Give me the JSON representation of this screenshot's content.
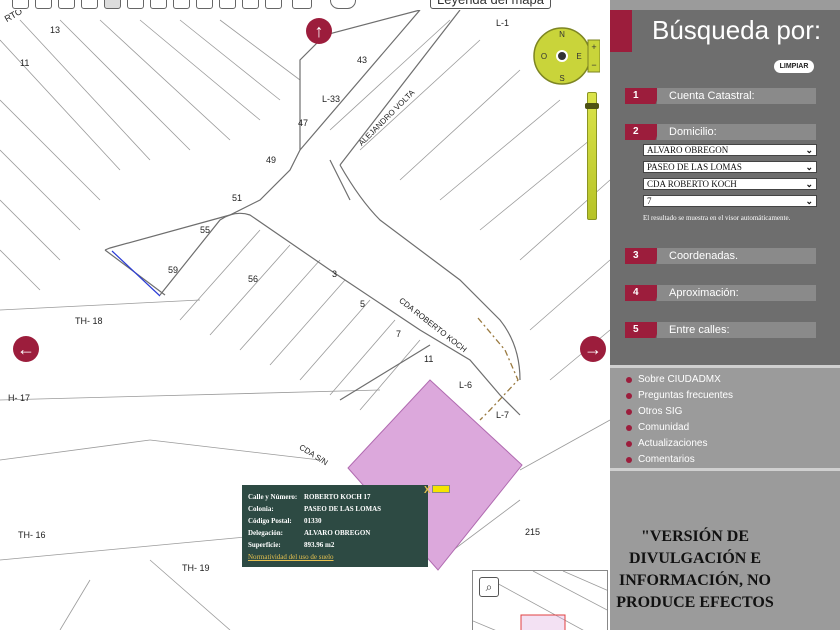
{
  "toolbar": {
    "tools": [
      "pan-tool",
      "zoom-in-tool",
      "zoom-out-tool",
      "extent-tool",
      "select-tool",
      "info-tool",
      "identify-tool",
      "measure-tool",
      "search-tool",
      "marker-tool",
      "route-tool",
      "area-tool",
      "print-tool",
      "view-tool"
    ],
    "legend_label": "Leyenda del mapa"
  },
  "map": {
    "labels": {
      "arto": "RTO",
      "n13": "13",
      "n11": "11",
      "l1": "L-1",
      "n43": "43",
      "l33": "L-33",
      "alejandro": "ALEJANDRO VOLTA",
      "n47": "47",
      "n49": "49",
      "n51": "51",
      "n55": "55",
      "n59": "59",
      "n56": "56",
      "n3": "3",
      "n5": "5",
      "n7": "7",
      "n11b": "11",
      "cda_roberto": "CDA ROBERTO KOCH",
      "l6": "L-6",
      "l7": "L-7",
      "th18": "TH- 18",
      "h17": "H- 17",
      "cda_sn": "CDA S/N",
      "n215": "215",
      "th16": "TH- 16",
      "th19": "TH- 19"
    },
    "colors": {
      "parcel": "#dca8dc",
      "street_line": "#6e6e6e",
      "accent": "#9c1d3c",
      "compass": "#c9d43a"
    },
    "compass": {
      "n": "N",
      "s": "S",
      "o": "O",
      "e": "E"
    }
  },
  "popup": {
    "rows": [
      {
        "k": "Calle y Número:",
        "v": "ROBERTO KOCH 17"
      },
      {
        "k": "Colonia:",
        "v": "PASEO DE LAS LOMAS"
      },
      {
        "k": "Código Postal:",
        "v": "01330"
      },
      {
        "k": "Delegación:",
        "v": "ALVARO OBREGON"
      },
      {
        "k": "Superficie:",
        "v": "893.96 m2"
      }
    ],
    "link": "Normatividad del uso de suelo",
    "close": "X"
  },
  "sidebar": {
    "title": "Búsqueda por:",
    "limpiar": "LIMPIAR",
    "sections": [
      {
        "num": "1",
        "label": "Cuenta Catastral:"
      },
      {
        "num": "2",
        "label": "Domicilio:"
      },
      {
        "num": "3",
        "label": "Coordenadas."
      },
      {
        "num": "4",
        "label": "Aproximación:"
      },
      {
        "num": "5",
        "label": "Entre calles:"
      }
    ],
    "selects": [
      "ALVARO OBREGON",
      "PASEO DE LAS LOMAS",
      "CDA ROBERTO KOCH",
      "7"
    ],
    "hint": "El resultado se muestra en el visor automáticamente.",
    "links": [
      "Sobre CIUDADMX",
      "Preguntas frecuentes",
      "Otros SIG",
      "Comunidad",
      "Actualizaciones",
      "Comentarios"
    ],
    "notice": "\"VERSIÓN DE DIVULGACIÓN E INFORMACIÓN, NO PRODUCE EFECTOS"
  }
}
